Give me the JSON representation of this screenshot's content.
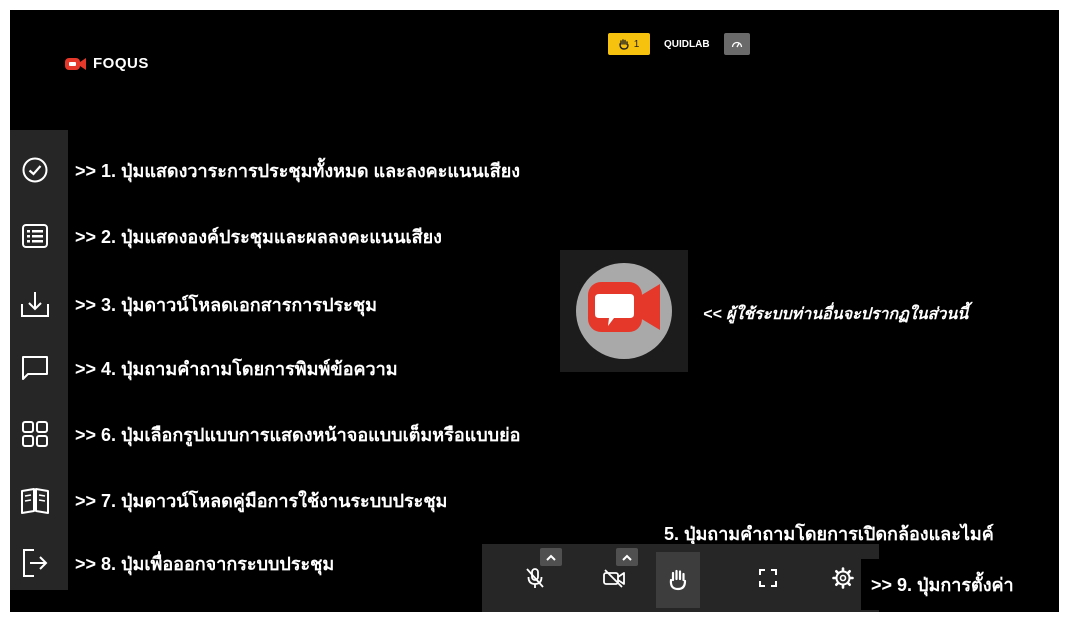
{
  "app": {
    "logo_text": "FOQUS"
  },
  "topbar": {
    "hand_count": "1",
    "room_name": "QUIDLAB"
  },
  "menu": [
    {
      "icon": "check-circle-icon",
      "label": ">> 1.  ปุ่มแสดงวาระการประชุมทั้งหมด และลงคะแนนเสียง"
    },
    {
      "icon": "list-icon",
      "label": ">> 2.  ปุ่มแสดงองค์ประชุมและผลลงคะแนนเสียง"
    },
    {
      "icon": "download-icon",
      "label": ">> 3.  ปุ่มดาวน์โหลดเอกสารการประชุม"
    },
    {
      "icon": "chat-icon",
      "label": ">> 4.  ปุ่มถามคำถามโดยการพิมพ์ข้อความ"
    },
    {
      "icon": "grid-icon",
      "label": ">> 6.  ปุ่มเลือกรูปแบบการแสดงหน้าจอแบบเต็มหรือแบบย่อ"
    },
    {
      "icon": "manual-icon",
      "label": ">> 7.  ปุ่มดาวน์โหลดคู่มือการใช้งานระบบประชุม"
    },
    {
      "icon": "exit-icon",
      "label": ">> 8.  ปุ่มเพื่อออกจากระบบประชุม"
    }
  ],
  "participants_note": "<< ผู้ใช้ระบบท่านอื่นจะปรากฏในส่วนนี้",
  "caption_5": "5. ปุ่มถามคำถามโดยการเปิดกล้องและไมค์",
  "caption_9": ">> 9. ปุ่มการตั้งค่า",
  "colors": {
    "brand_red": "#e5382b",
    "hand_badge": "#f6c20e",
    "background": "#000000"
  }
}
